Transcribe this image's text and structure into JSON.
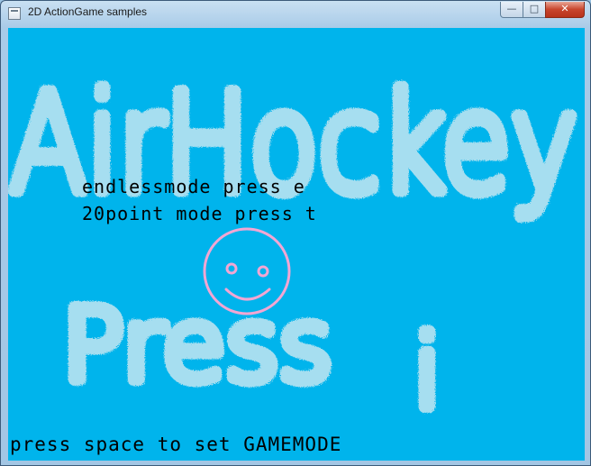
{
  "window": {
    "title": "2D ActionGame samples",
    "buttons": {
      "minimize": "—",
      "maximize": "□",
      "close": "✕"
    }
  },
  "game": {
    "background_color": "#00b4ec",
    "logo_color": "#a6def0",
    "smiley_color": "#f3a6d3",
    "logo_title": "AirHockey",
    "press_text": "Press",
    "press_key": "i",
    "menu": {
      "endless": "endlessmode press e",
      "point": "20point mode press t"
    },
    "footer": "press space to set GAMEMODE"
  }
}
